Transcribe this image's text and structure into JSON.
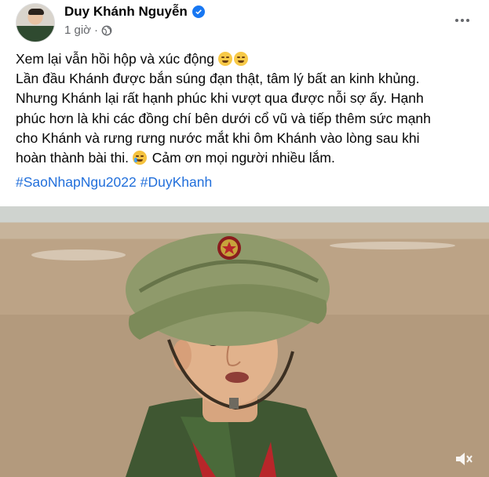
{
  "post": {
    "author": "Duy Khánh Nguyễn",
    "time": "1 giờ",
    "lines": [
      "Xem lại vẫn hồi hộp và xúc động",
      "Lần đầu Khánh được bắn súng đạn thật, tâm lý bất an kinh khủng.",
      "Nhưng Khánh lại rất hạnh phúc khi vượt qua được nỗi sợ ấy. Hạnh",
      "phúc hơn là khi các đồng chí bên dưới cổ vũ và tiếp thêm sức mạnh",
      "cho Khánh và rưng rưng nước mắt khi ôm Khánh vào lòng sau khi",
      "hoàn thành bài thi.",
      "Cảm ơn mọi người nhiều lắm."
    ],
    "hashtags": [
      "#SaoNhapNgu2022",
      "#DuyKhanh"
    ]
  },
  "icons": {
    "verified": "verified-badge-icon",
    "privacy": "globe-icon",
    "more": "more-options-icon",
    "sound": "speaker-icon"
  },
  "colors": {
    "link": "#216fdb",
    "secondary_text": "#65676b",
    "verified": "#1877f2"
  }
}
